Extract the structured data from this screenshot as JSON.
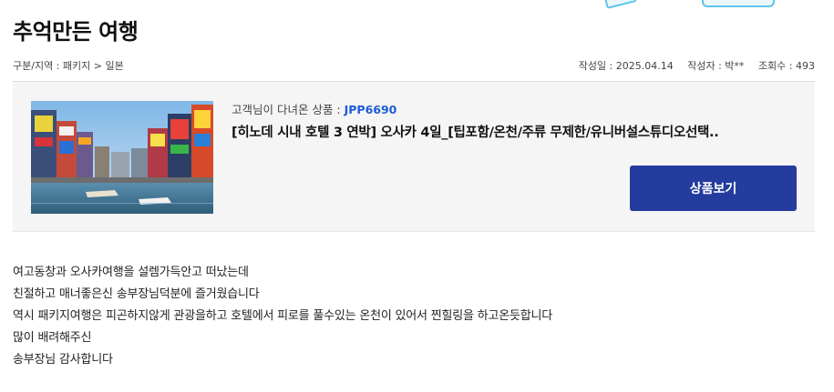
{
  "page": {
    "title": "추억만든 여행"
  },
  "meta": {
    "breadcrumb": "구분/지역 : 패키지 > 일본",
    "date": "작성일 : 2025.04.14",
    "author": "작성자 : 박**",
    "views": "조회수 : 493"
  },
  "product": {
    "label_prefix": "고객님이 다녀온 상품 : ",
    "code": "JPP6690",
    "name": "[히노데 시내 호텔 3 연박] 오사카 4일_[팁포함/온천/주류 무제한/유니버설스튜디오선택..",
    "button_label": "상품보기",
    "image_icon": "osaka-dotonbori-photo"
  },
  "content": {
    "lines": [
      "여고동창과 오사카여행을 설렘가득안고 떠났는데",
      "친절하고 매너좋은신 송부장님덕분에 즐거웠습니다",
      "역시 패키지여행은 피곤하지않게 관광을하고 호텔에서 피로를 풀수있는 온천이 있어서 찐힐링을 하고온듯합니다",
      "많이 배려해주신",
      "송부장님 감사합니다"
    ]
  },
  "colors": {
    "accent": "#243c9e",
    "code": "#1e5bd6",
    "box_bg": "#f5f5f5",
    "deco": "#5ec4ea"
  }
}
